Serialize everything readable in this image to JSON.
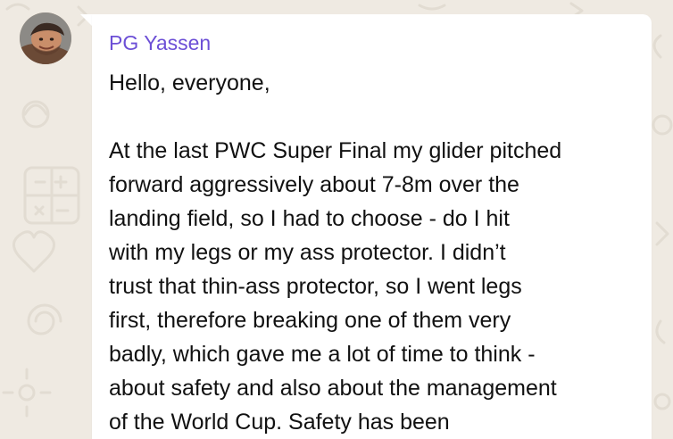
{
  "theme": {
    "background": "#efeae2",
    "bubble": "#ffffff",
    "sender_color": "#6c4fd6",
    "text_color": "#111111"
  },
  "message": {
    "sender": "PG Yassen",
    "avatar_icon": "user-avatar-photo",
    "greeting": "Hello, everyone,",
    "lines": [
      "At the last PWC Super Final my glider pitched",
      "forward aggressively about 7-8m over the",
      "landing field, so I had to choose - do I hit",
      "with my legs or my ass protector.  I didn’t",
      "trust that thin-ass protector, so I went legs",
      "first, therefore breaking one of them very",
      "badly, which gave me a lot of time to think -",
      "about safety and also about the management",
      "of the World Cup.  Safety has been"
    ]
  }
}
